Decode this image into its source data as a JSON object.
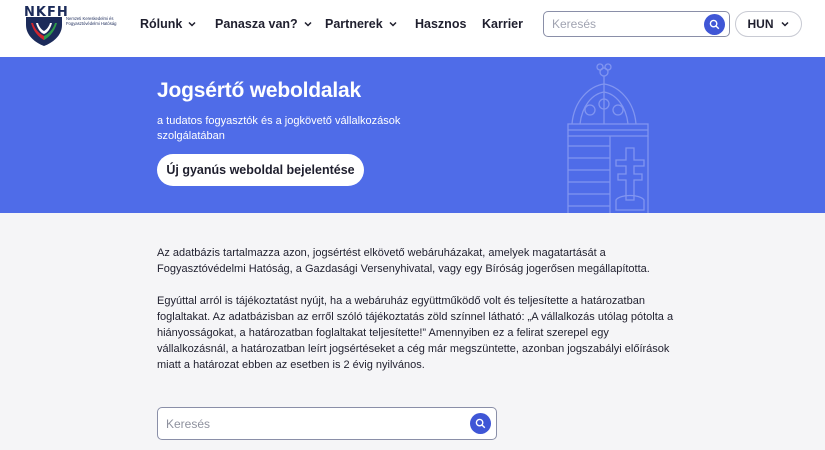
{
  "logo": {
    "abbr": "NKFH",
    "subtitle": "Nemzeti Kereskedelmi és Fogyasztóvédelmi Hatóság"
  },
  "nav": {
    "items": [
      {
        "label": "Rólunk",
        "has_dropdown": true
      },
      {
        "label": "Panasza van?",
        "has_dropdown": true
      },
      {
        "label": "Partnerek",
        "has_dropdown": true
      },
      {
        "label": "Hasznos",
        "has_dropdown": false
      },
      {
        "label": "Karrier",
        "has_dropdown": false
      }
    ],
    "search_placeholder": "Keresés",
    "language": "HUN"
  },
  "hero": {
    "title": "Jogsértő weboldalak",
    "lead": "a tudatos fogyasztók és a jogkövető vállalkozások szolgálatában",
    "cta": "Új gyanús weboldal bejelentése",
    "background_color": "#4f6ce8"
  },
  "content": {
    "paragraph_1": "Az adatbázis tartalmazza azon, jogsértést elkövető webáruházakat, amelyek magatartását a Fogyasztóvédelmi Hatóság, a Gazdasági Versenyhivatal, vagy egy Bíróság jogerősen megállapította.",
    "paragraph_2": "Egyúttal arról is tájékoztatást nyújt, ha a webáruház együttműködő volt és teljesítette a határozatban foglaltakat. Az adatbázisban az erről szóló tájékoztatás zöld színnel látható: „A vállalkozás utólag pótolta a hiányosságokat, a határozatban foglaltakat teljesítette!” Amennyiben ez a felirat szerepel egy vállalkozásnál, a határozatban leírt jogsértéseket a cég már megszüntette, azonban jogszabályi előírások miatt a határozat ebben az esetben is 2 évig nyilvános.",
    "search_placeholder": "Keresés"
  },
  "colors": {
    "accent": "#3f56d6",
    "hero": "#4f6ce8",
    "page_bg": "#f5f5f7"
  }
}
